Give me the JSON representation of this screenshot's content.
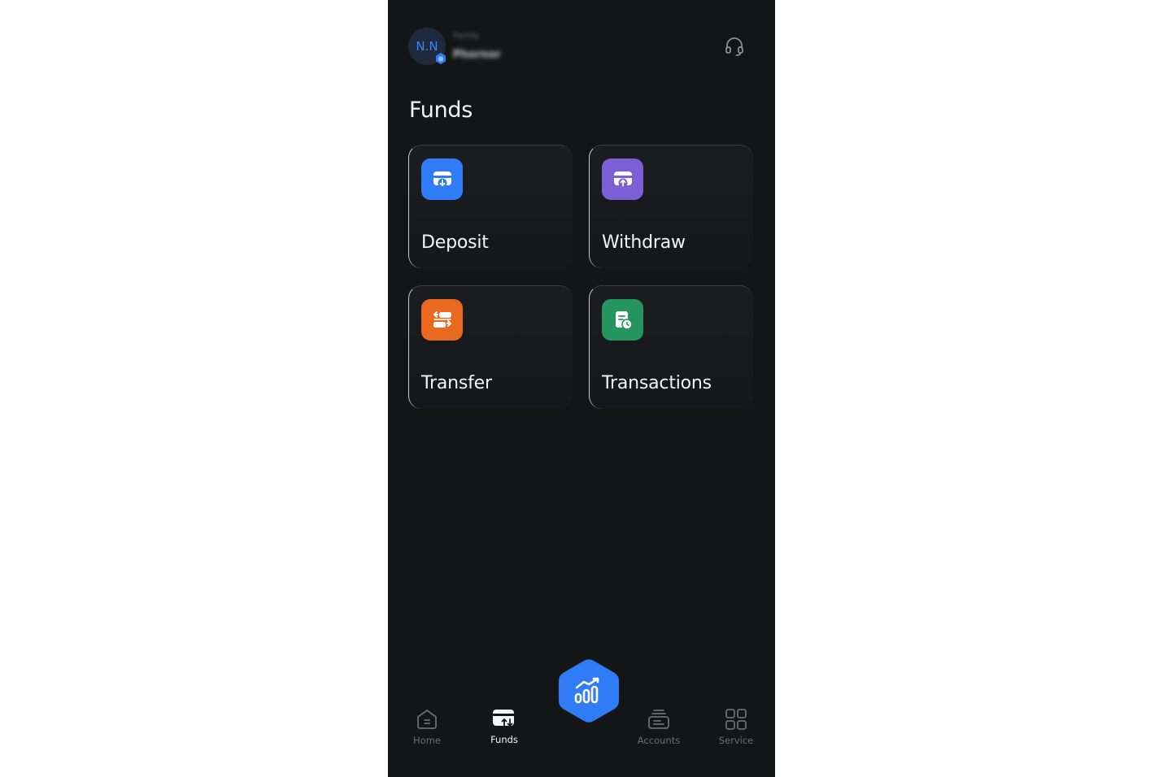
{
  "header": {
    "avatar_initials": "N.N",
    "user_name_top": "Family",
    "user_name_bottom": "Phornor",
    "support_icon": "headset-icon"
  },
  "page": {
    "title": "Funds"
  },
  "tiles": [
    {
      "label": "Deposit",
      "icon": "deposit-icon",
      "color": "#2f7cf6"
    },
    {
      "label": "Withdraw",
      "icon": "withdraw-icon",
      "color": "#7b5fd6"
    },
    {
      "label": "Transfer",
      "icon": "transfer-icon",
      "color": "#e8691f"
    },
    {
      "label": "Transactions",
      "icon": "transactions-icon",
      "color": "#25955f"
    }
  ],
  "nav": {
    "items": [
      {
        "label": "Home",
        "icon": "home-icon",
        "active": false
      },
      {
        "label": "Funds",
        "icon": "funds-icon",
        "active": true
      },
      {
        "label": "Accounts",
        "icon": "accounts-icon",
        "active": false
      },
      {
        "label": "Service",
        "icon": "service-grid-icon",
        "active": false
      }
    ],
    "center_icon": "trade-chart-icon",
    "accent": "#2f7cf6"
  }
}
